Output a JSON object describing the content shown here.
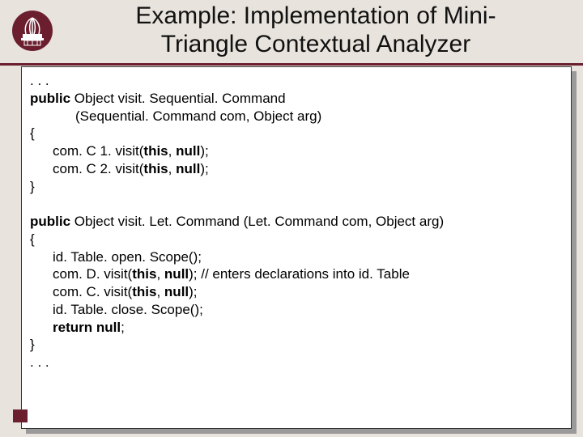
{
  "title_line1": "Example: Implementation of Mini-",
  "title_line2": "Triangle Contextual Analyzer",
  "code": {
    "ellipsis_top": ". . .",
    "seq_sig1_a": "public",
    "seq_sig1_b": " Object visit. Sequential. Command",
    "seq_sig2": "(Sequential. Command com, Object arg)",
    "open1": "{",
    "seq_body1_a": "com. C 1. visit(",
    "seq_body1_b": "this",
    "seq_body1_c": ", ",
    "seq_body1_d": "null",
    "seq_body1_e": ");",
    "seq_body2_a": "com. C 2. visit(",
    "seq_body2_b": "this",
    "seq_body2_c": ", ",
    "seq_body2_d": "null",
    "seq_body2_e": ");",
    "close1": "}",
    "let_sig_a": "public",
    "let_sig_b": " Object visit. Let. Command (Let. Command com, Object arg)",
    "open2": "{",
    "let_body1": "id. Table. open. Scope();",
    "let_body2_a": "com. D. visit(",
    "let_body2_b": "this",
    "let_body2_c": ", ",
    "let_body2_d": "null",
    "let_body2_e": "); // enters declarations into id. Table",
    "let_body3_a": "com. C. visit(",
    "let_body3_b": "this",
    "let_body3_c": ", ",
    "let_body3_d": "null",
    "let_body3_e": ");",
    "let_body4": "id. Table. close. Scope();",
    "let_ret_a": "return",
    "let_ret_b": " ",
    "let_ret_c": "null",
    "let_ret_d": ";",
    "close2": "}",
    "ellipsis_bot": ". . ."
  }
}
